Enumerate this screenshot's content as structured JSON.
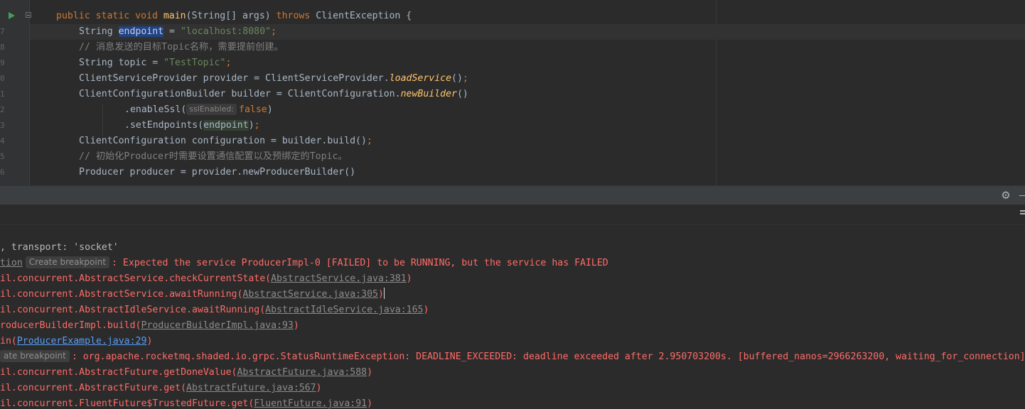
{
  "editor": {
    "lines": {
      "l1": {
        "kw1": "public static void ",
        "fn": "main",
        "p1": "(String[] args) ",
        "kw2": "throws",
        "p2": " ClientException {"
      },
      "l2": {
        "p1": "String ",
        "sel": "endpoint",
        "p2": " = ",
        "str": "\"localhost:8080\"",
        "semi": ";"
      },
      "l3": {
        "comment": "// 消息发送的目标Topic名称，需要提前创建。"
      },
      "l4": {
        "p1": "String topic = ",
        "str": "\"TestTopic\"",
        "semi": ";"
      },
      "l5": {
        "p1": "ClientServiceProvider provider = ClientServiceProvider.",
        "it": "loadService",
        "p2": "()",
        "semi": ";"
      },
      "l6": {
        "p1": "ClientConfigurationBuilder builder = ClientConfiguration.",
        "it": "newBuilder",
        "p2": "()"
      },
      "l7": {
        "p1": ".enableSsl(",
        "hint": "sslEnabled:",
        "kw": "false",
        "p2": ")"
      },
      "l8": {
        "p1": ".setEndpoints(",
        "hl": "endpoint",
        "p2": ")",
        "semi": ";"
      },
      "l9": {
        "p1": "ClientConfiguration configuration = builder.build()",
        "semi": ";"
      },
      "l10": {
        "comment": "// 初始化Producer时需要设置通信配置以及预绑定的Topic。"
      },
      "l11": {
        "p1": "Producer producer = provider.newProducerBuilder()"
      }
    }
  },
  "console": {
    "l1": ", transport: 'socket'",
    "l2": {
      "tail": "tion",
      "bp": "Create breakpoint",
      "msg": ": Expected the service ProducerImpl-0 [FAILED] to be RUNNING, but the service has FAILED"
    },
    "l3": {
      "pre": "il.concurrent.AbstractService.checkCurrentState(",
      "link": "AbstractService.java:381",
      "post": ")"
    },
    "l4": {
      "pre": "il.concurrent.AbstractService.awaitRunning(",
      "link": "AbstractService.java:305",
      "post": ")"
    },
    "l5": {
      "pre": "il.concurrent.AbstractIdleService.awaitRunning(",
      "link": "AbstractIdleService.java:165",
      "post": ")"
    },
    "l6": {
      "pre": "roducerBuilderImpl.build(",
      "link": "ProducerBuilderImpl.java:93",
      "post": ")"
    },
    "l7": {
      "pre": "in(",
      "link": "ProducerExample.java:29",
      "post": ")"
    },
    "l8": {
      "bp": "ate breakpoint",
      "msg": ": org.apache.rocketmq.shaded.io.grpc.StatusRuntimeException: DEADLINE_EXCEEDED: deadline exceeded after 2.950703200s. [buffered_nanos=2966263200, waiting_for_connection]"
    },
    "l9": {
      "pre": "il.concurrent.AbstractFuture.getDoneValue(",
      "link": "AbstractFuture.java:588",
      "post": ")"
    },
    "l10": {
      "pre": "il.concurrent.AbstractFuture.get(",
      "link": "AbstractFuture.java:567",
      "post": ")"
    },
    "l11": {
      "pre": "il.concurrent.FluentFuture$TrustedFuture.get(",
      "link": "FluentFuture.java:91",
      "post": ")"
    }
  },
  "icons": {
    "run": "run-gutter-icon",
    "fold": "fold-icon",
    "settings": "gear-icon",
    "minimize": "minimize-icon",
    "wrap": "soft-wrap-icon"
  },
  "colors": {
    "keyword": "#cc7832",
    "string": "#6a8759",
    "function": "#ffc66d",
    "comment": "#808080",
    "error": "#ff6b68",
    "link": "#589df6",
    "selection": "#214283"
  }
}
